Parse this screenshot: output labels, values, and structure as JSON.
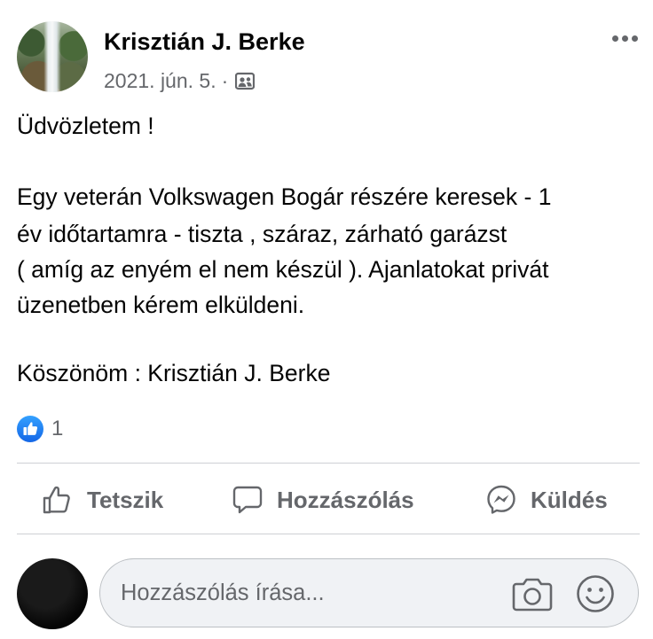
{
  "post": {
    "author": "Krisztián J. Berke",
    "date": "2021. jún. 5.",
    "separator": "·",
    "audience_icon": "members-group-icon",
    "greeting": "Üdvözletem !",
    "body_lines": [
      "Egy veterán Volkswagen Bogár részére keresek - 1",
      "év időtartamra - tiszta , száraz, zárható garázst",
      "( amíg az enyém el nem készül ). Ajanlatokat privát",
      "üzenetben kérem elküldeni."
    ],
    "closing": "Köszönöm : Krisztián J. Berke"
  },
  "reactions": {
    "icon": "like-reaction-icon",
    "count": "1"
  },
  "actions": {
    "like_label": "Tetszik",
    "comment_label": "Hozzászólás",
    "send_label": "Küldés"
  },
  "composer": {
    "placeholder": "Hozzászólás írása...",
    "icons": [
      "camera-icon",
      "emoji-icon"
    ]
  },
  "colors": {
    "text": "#050505",
    "secondary_text": "#65676b",
    "like_blue": "#1877f2",
    "divider": "#ced0d4",
    "composer_bg": "#f0f2f5"
  }
}
